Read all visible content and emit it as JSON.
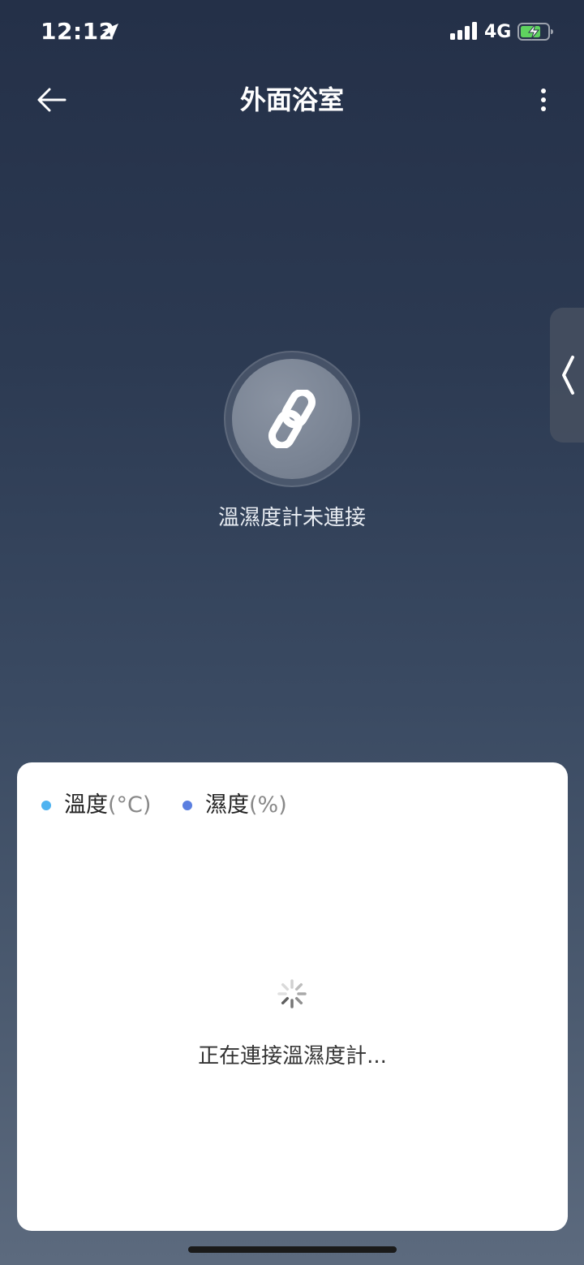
{
  "status_bar": {
    "time": "12:12",
    "network": "4G",
    "icons": [
      "location-arrow-icon",
      "signal-icon",
      "battery-charging-icon"
    ]
  },
  "header": {
    "title": "外面浴室",
    "back_icon": "arrow-left-icon",
    "more_icon": "more-vertical-icon"
  },
  "status": {
    "icon": "link-icon",
    "message": "溫濕度計未連接"
  },
  "side_handle": {
    "icon": "chevron-left-icon"
  },
  "chart_card": {
    "legend": [
      {
        "label": "溫度",
        "unit": "(°C)",
        "color": "#4fb3f0"
      },
      {
        "label": "濕度",
        "unit": "(%)",
        "color": "#5b7fe0"
      }
    ],
    "loading_icon": "spinner-icon",
    "loading_text": "正在連接溫濕度計..."
  },
  "colors": {
    "background_top": "#243048",
    "background_bottom": "#5c6a7e",
    "card": "#ffffff"
  }
}
